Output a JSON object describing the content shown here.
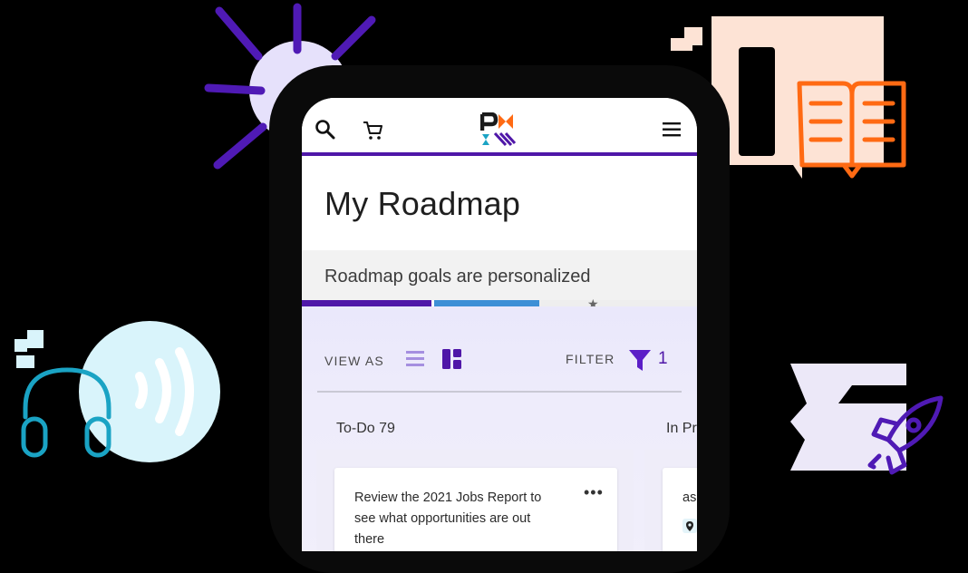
{
  "app": {
    "brand_logo": "pmi-logo",
    "nav_icons": [
      "search-icon",
      "cart-icon",
      "hamburger-menu-icon"
    ]
  },
  "page": {
    "title": "My Roadmap",
    "banner": "Roadmap goals are personalized"
  },
  "progress": {
    "segments": [
      {
        "color": "#4f17a8",
        "share": 0.33
      },
      {
        "color": "#3d8fd6",
        "share": 0.27
      },
      {
        "color": "#eeeeee",
        "share": 0.4
      }
    ]
  },
  "toolbar": {
    "view_as_label": "VIEW AS",
    "view_icons": [
      "list-view-icon",
      "board-view-icon"
    ],
    "filter_label": "FILTER",
    "filter_count": "1"
  },
  "columns": [
    {
      "title": "To-Do 79",
      "cards": [
        {
          "text": [
            "Review the 2021 Jobs Report to",
            "see what opportunities are out",
            "there"
          ]
        }
      ]
    },
    {
      "title": "In Pr",
      "cards": [
        {
          "text": [
            "as"
          ]
        }
      ]
    }
  ],
  "colors": {
    "brand_purple": "#4f17a8",
    "accent_blue": "#3d8fd6",
    "deco_orange": "#ff6a13",
    "deco_teal": "#1aa3c4"
  }
}
